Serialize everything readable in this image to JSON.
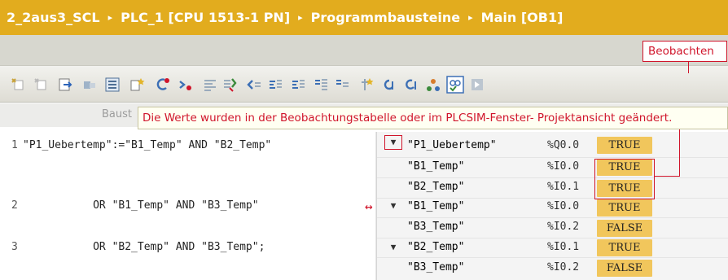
{
  "breadcrumb": {
    "project": "2_2aus3_SCL",
    "plc": "PLC_1 [CPU 1513-1 PN]",
    "folder": "Programmbausteine",
    "block": "Main [OB1]",
    "separator": "▸"
  },
  "callout": {
    "beobachten": "Beobachten"
  },
  "toolbar": {
    "icons": [
      "insert-network-icon",
      "delete-network-icon",
      "insert-row-icon",
      "delete-row-icon",
      "block-interface-icon",
      "favorites-icon",
      "clear-cross-reference-icon",
      "update-calls-icon",
      "compare-icon",
      "compile-icon",
      "indent-left-icon",
      "indent-right-icon",
      "outdent-icon",
      "comment-icon",
      "uncomment-icon",
      "bookmark-icon",
      "go-to-icon",
      "go-back-icon",
      "go-online-icon",
      "monitor-icon",
      "snapshot-icon"
    ]
  },
  "colhead": {
    "baust": "Baust"
  },
  "tooltip": {
    "text": "Die Werte wurden in der Beobachtungstabelle oder im PLCSIM-Fenster- Projektansicht geändert."
  },
  "code": {
    "lines": [
      {
        "num": "1",
        "text": "\"P1_Uebertemp\":=\"B1_Temp\" AND \"B2_Temp\""
      },
      {
        "num": "2",
        "text": "           OR \"B1_Temp\" AND \"B3_Temp\""
      },
      {
        "num": "3",
        "text": "           OR \"B2_Temp\" AND \"B3_Temp\";"
      }
    ]
  },
  "monitor": {
    "rows": [
      {
        "var": "\"P1_Uebertemp\"",
        "addr": "%Q0.0",
        "value": "TRUE"
      },
      {
        "var": "\"B1_Temp\"",
        "addr": "%I0.0",
        "value": "TRUE"
      },
      {
        "var": "\"B2_Temp\"",
        "addr": "%I0.1",
        "value": "TRUE"
      },
      {
        "var": "\"B1_Temp\"",
        "addr": "%I0.0",
        "value": "TRUE"
      },
      {
        "var": "\"B3_Temp\"",
        "addr": "%I0.2",
        "value": "FALSE"
      },
      {
        "var": "\"B2_Temp\"",
        "addr": "%I0.1",
        "value": "TRUE"
      },
      {
        "var": "\"B3_Temp\"",
        "addr": "%I0.2",
        "value": "FALSE"
      }
    ],
    "value_color": "#f1c65c"
  },
  "colors": {
    "title_bg": "#e2ac1e",
    "accent_red": "#d0152b"
  }
}
